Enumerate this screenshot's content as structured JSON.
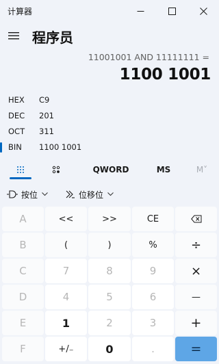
{
  "window": {
    "app_title": "计算器",
    "minimize_glyph": "—",
    "maximize_glyph": "☐",
    "close_glyph": "✕"
  },
  "header": {
    "mode_title": "程序员",
    "menu_icon": "hamburger-icon"
  },
  "display": {
    "expression": "11001001 AND 11111111 =",
    "result": "1100 1001"
  },
  "radix": [
    {
      "label": "HEX",
      "value": "C9"
    },
    {
      "label": "DEC",
      "value": "201"
    },
    {
      "label": "OCT",
      "value": "311"
    },
    {
      "label": "BIN",
      "value": "1100 1001",
      "selected": true
    }
  ],
  "tabs": {
    "keypad_icon": "keypad-grid-icon",
    "bit_toggle_icon": "bit-toggle-icon",
    "word_size": "QWORD",
    "memory_store": "MS",
    "memory_view": "M˅"
  },
  "ops": {
    "bitwise_label": "按位",
    "shift_label": "位移位"
  },
  "keys": {
    "r1": [
      "A",
      "<<",
      ">>",
      "CE",
      "⌫"
    ],
    "r2": [
      "B",
      "(",
      ")",
      "%",
      "÷"
    ],
    "r3": [
      "C",
      "7",
      "8",
      "9",
      "×"
    ],
    "r4": [
      "D",
      "4",
      "5",
      "6",
      "—"
    ],
    "r5": [
      "E",
      "1",
      "2",
      "3",
      "+"
    ],
    "r6": [
      "F",
      "+/₋",
      "0",
      ".",
      "="
    ]
  },
  "colors": {
    "accent": "#0067c0",
    "equals_key": "#5ea6e6",
    "background": "#f0f3f9"
  }
}
